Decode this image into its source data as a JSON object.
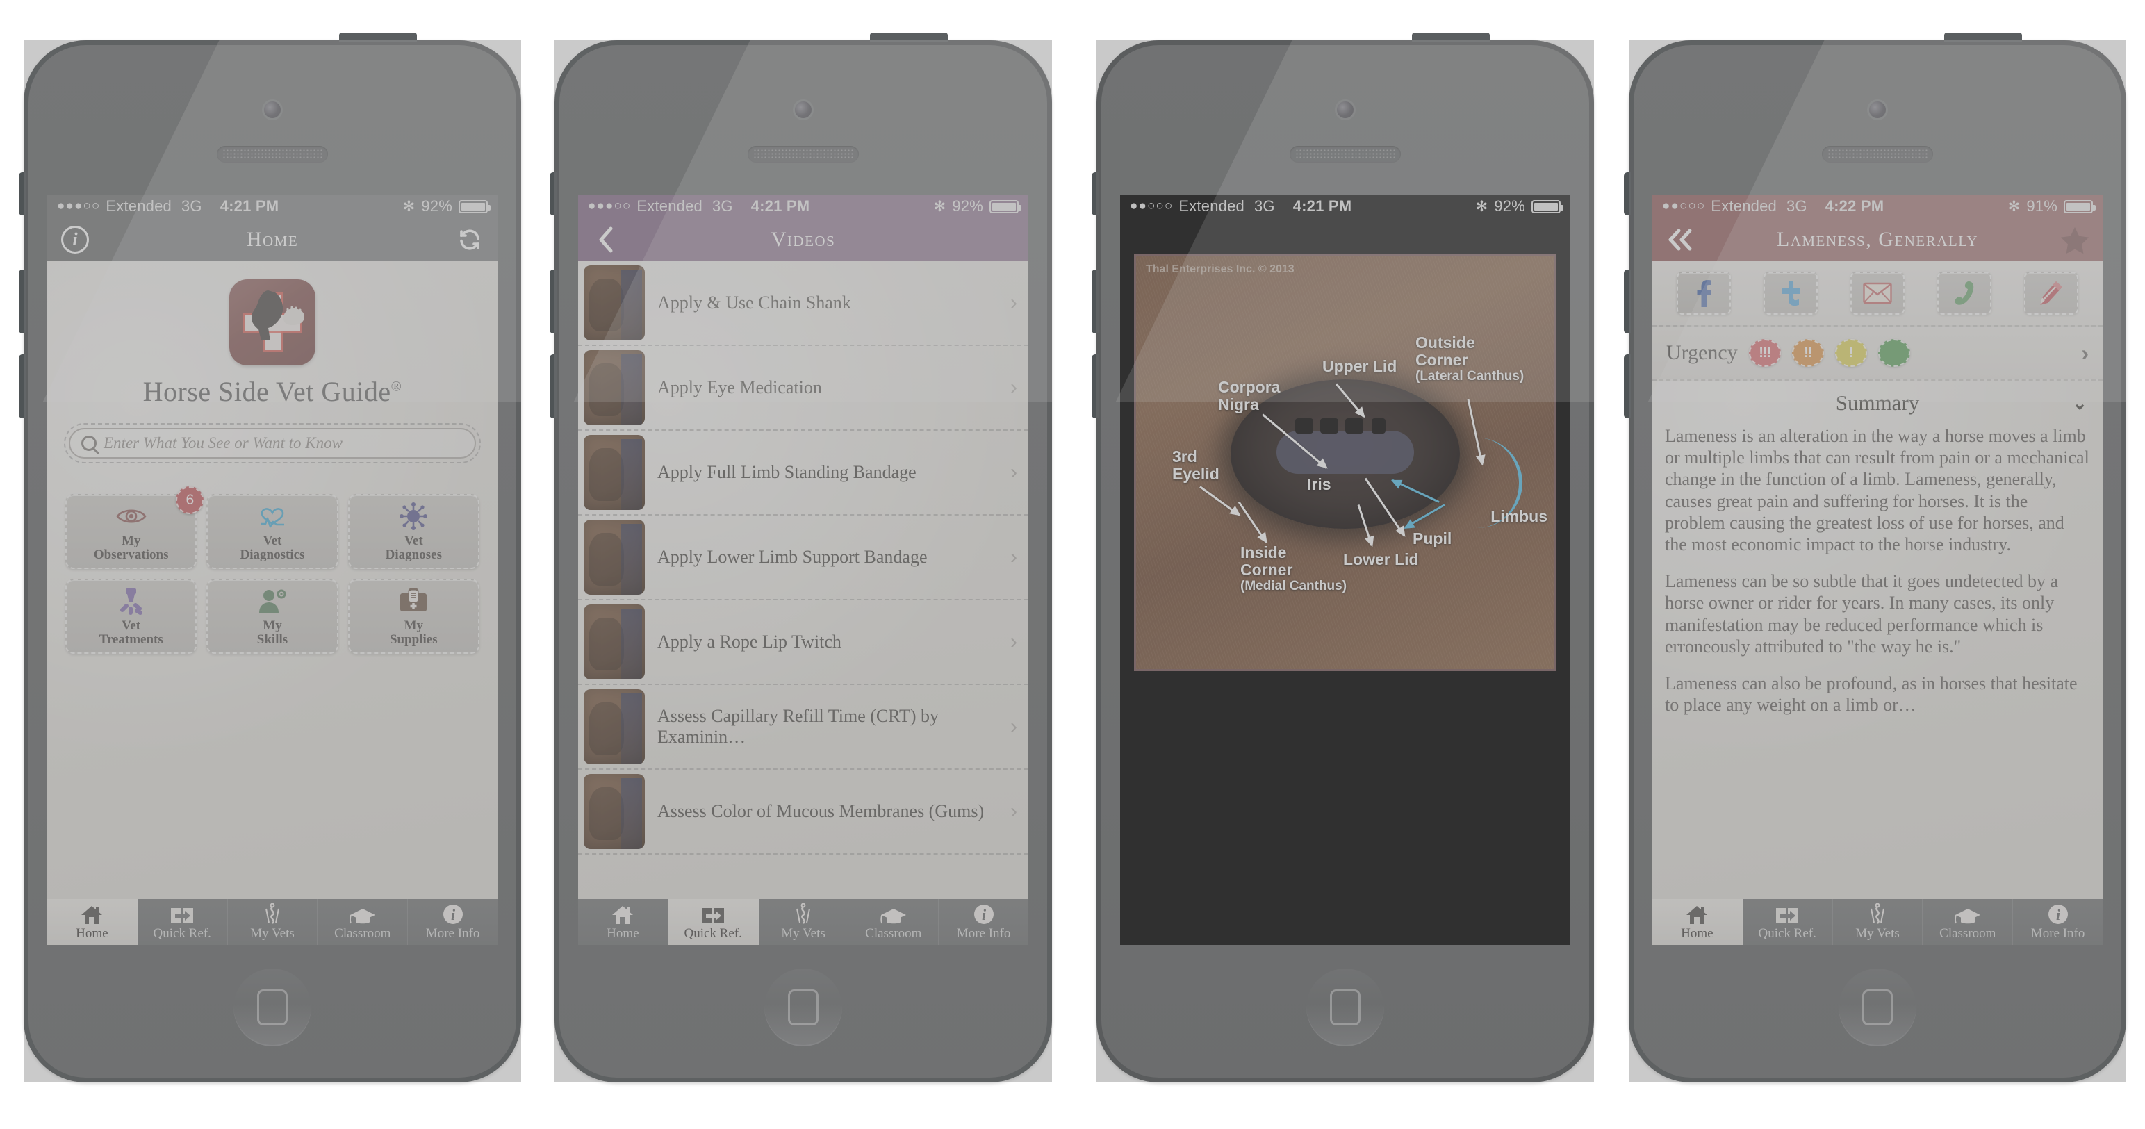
{
  "app": {
    "name": "Horse Side Vet Guide",
    "registered_mark": "®"
  },
  "phones": [
    {
      "id": "phone-home",
      "status_bar": {
        "signal_dots": "●●●○○",
        "carrier": "Extended",
        "network": "3G",
        "time": "4:21 PM",
        "battery_percent": "92%"
      },
      "navbar": {
        "title": "Home",
        "left_icon": "info-icon",
        "right_icon": "refresh-icon",
        "bg_color": "#7a7c7d"
      },
      "search": {
        "placeholder": "Enter What You See or Want to Know",
        "value": ""
      },
      "tiles": [
        {
          "label_line1": "My",
          "label_line2": "Observations",
          "icon": "eye-icon",
          "icon_color": "#9a6a68",
          "badge": "6"
        },
        {
          "label_line1": "Vet",
          "label_line2": "Diagnostics",
          "icon": "heart-pulse-icon",
          "icon_color": "#56b4d9",
          "badge": ""
        },
        {
          "label_line1": "Vet",
          "label_line2": "Diagnoses",
          "icon": "pathogen-icon",
          "icon_color": "#6a6a9c",
          "badge": ""
        },
        {
          "label_line1": "Vet",
          "label_line2": "Treatments",
          "icon": "syringe-pills-icon",
          "icon_color": "#8e7bb5",
          "badge": ""
        },
        {
          "label_line1": "My",
          "label_line2": "Skills",
          "icon": "person-gear-icon",
          "icon_color": "#6f8f74",
          "badge": ""
        },
        {
          "label_line1": "My",
          "label_line2": "Supplies",
          "icon": "medical-kit-icon",
          "icon_color": "#7d6a5c",
          "badge": ""
        }
      ]
    },
    {
      "id": "phone-videos",
      "status_bar": {
        "signal_dots": "●●●○○",
        "carrier": "Extended",
        "network": "3G",
        "time": "4:21 PM",
        "battery_percent": "92%"
      },
      "navbar": {
        "title": "Videos",
        "left_icon": "back-chevron-icon",
        "right_icon": "",
        "bg_color": "#8e7691"
      },
      "videos": [
        "Apply & Use Chain Shank",
        "Apply Eye Medication",
        "Apply Full Limb Standing Bandage",
        "Apply Lower Limb Support Bandage",
        "Apply a Rope Lip Twitch",
        "Assess Capillary Refill Time (CRT) by Examinin…",
        "Assess Color of Mucous Membranes (Gums)"
      ]
    },
    {
      "id": "phone-eye-photo",
      "status_bar": {
        "signal_dots": "●●○○○",
        "carrier": "Extended",
        "network": "3G",
        "time": "4:21 PM",
        "battery_percent": "92%"
      },
      "photo": {
        "credit": "Thal Enterprises Inc.     © 2013",
        "labels": [
          {
            "name": "corpora-nigra",
            "line1": "Corpora",
            "line2": "Nigra",
            "sub": ""
          },
          {
            "name": "upper-lid",
            "line1": "Upper Lid",
            "line2": "",
            "sub": ""
          },
          {
            "name": "outside-corner",
            "line1": "Outside",
            "line2": "Corner",
            "sub": "(Lateral Canthus)"
          },
          {
            "name": "third-eyelid",
            "line1": "3rd",
            "line2": "Eyelid",
            "sub": ""
          },
          {
            "name": "iris",
            "line1": "Iris",
            "line2": "",
            "sub": ""
          },
          {
            "name": "limbus",
            "line1": "Limbus",
            "line2": "",
            "sub": ""
          },
          {
            "name": "pupil",
            "line1": "Pupil",
            "line2": "",
            "sub": ""
          },
          {
            "name": "lower-lid",
            "line1": "Lower Lid",
            "line2": "",
            "sub": ""
          },
          {
            "name": "inside-corner",
            "line1": "Inside",
            "line2": "Corner",
            "sub": "(Medial Canthus)"
          }
        ]
      }
    },
    {
      "id": "phone-detail",
      "status_bar": {
        "signal_dots": "●●○○○",
        "carrier": "Extended",
        "network": "3G",
        "time": "4:22 PM",
        "battery_percent": "91%"
      },
      "navbar": {
        "title": "Lameness, Generally",
        "left_icon": "double-back-chevron-icon",
        "right_icon": "star-icon",
        "bg_color": "#9d6b6b"
      },
      "social": [
        {
          "name": "facebook-icon",
          "color": "#5572b0"
        },
        {
          "name": "twitter-icon",
          "color": "#5aa9dd"
        },
        {
          "name": "email-icon",
          "color": "#c86a6a"
        },
        {
          "name": "phone-icon",
          "color": "#64a068"
        },
        {
          "name": "edit-pencil-icon",
          "color": "#c6565e"
        }
      ],
      "urgency": {
        "label": "Urgency",
        "levels": [
          {
            "marks": "!!!",
            "color": "#d9646a"
          },
          {
            "marks": "!!",
            "color": "#dd9140"
          },
          {
            "marks": "!",
            "color": "#ddd14e"
          },
          {
            "marks": "",
            "color": "#4f9a4f"
          }
        ],
        "chevron": "›"
      },
      "summary": {
        "heading": "Summary",
        "toggle": "⌄",
        "paragraphs": [
          "Lameness is an alteration in the way a horse moves a limb or multiple limbs that can result from pain or a mechanical change in the function of a limb. Lameness, generally, causes great pain and suffering for horses. It is the problem causing the greatest loss of use for horses, and the most economic impact to the horse industry.",
          "Lameness can be so subtle that it goes undetected by a horse owner or rider for years. In many cases, its only manifestation may be reduced performance which is erroneously attributed to \"the way he is.\"",
          "Lameness can also be profound, as in horses that hesitate to place any weight on a limb or…"
        ]
      }
    }
  ],
  "tabbar": {
    "items": [
      {
        "label": "Home",
        "icon": "house-icon"
      },
      {
        "label": "Quick Ref.",
        "icon": "book-arrow-icon"
      },
      {
        "label": "My Vets",
        "icon": "caduceus-icon"
      },
      {
        "label": "Classroom",
        "icon": "graduation-cap-icon"
      },
      {
        "label": "More Info",
        "icon": "info-circle-icon"
      }
    ],
    "active_home": 0,
    "active_quickref": 1
  }
}
